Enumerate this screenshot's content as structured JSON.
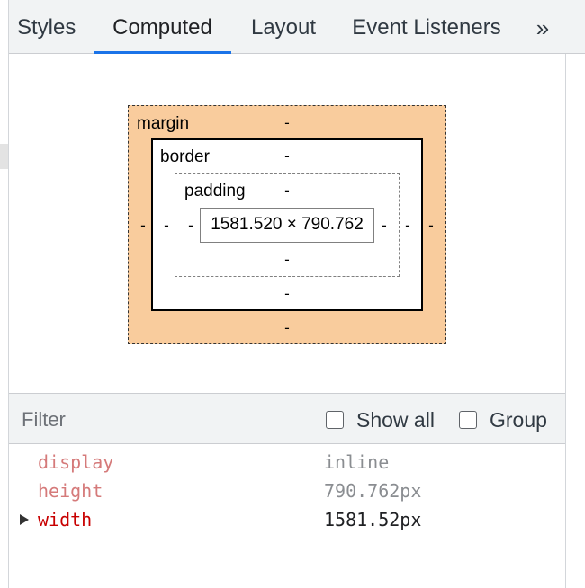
{
  "tabs": [
    {
      "label": "Styles"
    },
    {
      "label": "Computed"
    },
    {
      "label": "Layout"
    },
    {
      "label": "Event Listeners"
    }
  ],
  "active_tab": "Computed",
  "tab_overflow_label": "»",
  "box_model": {
    "margin_label": "margin",
    "border_label": "border",
    "padding_label": "padding",
    "content_size": "1581.520 × 790.762",
    "margin": {
      "top": "-",
      "right": "-",
      "bottom": "-",
      "left": "-"
    },
    "border": {
      "top": "-",
      "right": "-",
      "bottom": "-",
      "left": "-"
    },
    "padding": {
      "top": "-",
      "right": "-",
      "bottom": "-",
      "left": "-"
    },
    "colors": {
      "margin": "#f9cc9d",
      "border": "#000000",
      "padding": "#ffffff"
    }
  },
  "filter": {
    "placeholder": "Filter",
    "value": "",
    "show_all_label": "Show all",
    "show_all_checked": false,
    "group_label": "Group",
    "group_checked": false
  },
  "properties": [
    {
      "name": "display",
      "value": "inline",
      "inherited": true,
      "expandable": false
    },
    {
      "name": "height",
      "value": "790.762px",
      "inherited": true,
      "expandable": false
    },
    {
      "name": "width",
      "value": "1581.52px",
      "inherited": false,
      "expandable": true
    }
  ],
  "accent_color": "#1a73e8"
}
